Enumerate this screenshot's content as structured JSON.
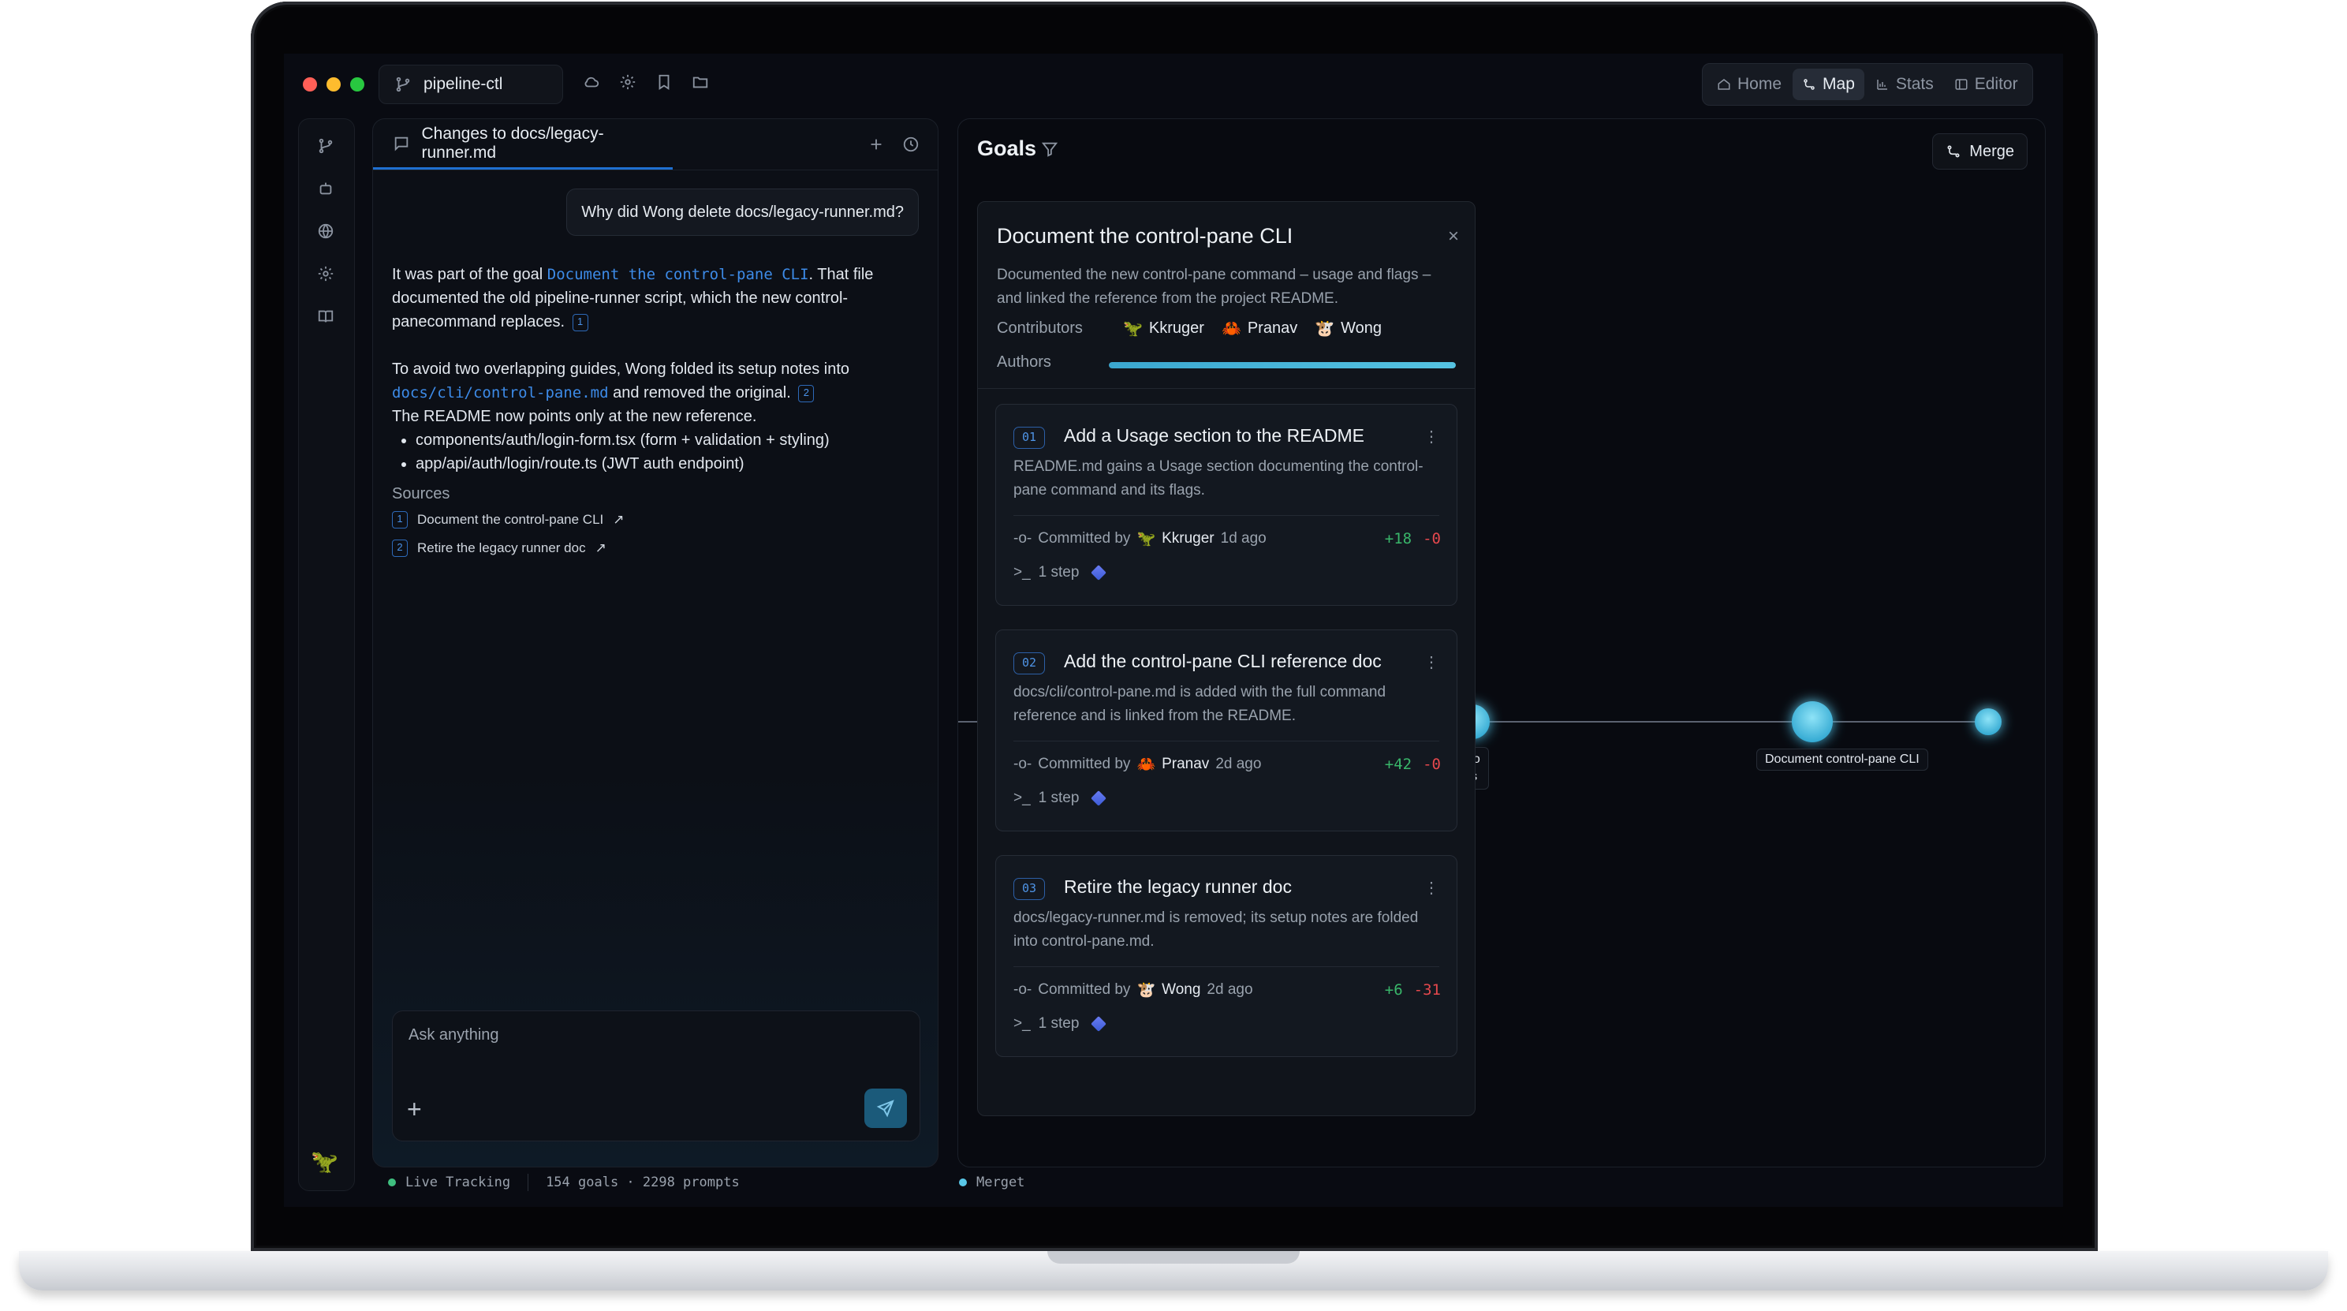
{
  "window": {
    "repo": "pipeline-ctl",
    "traffic_colors": [
      "#ff5f57",
      "#febc2e",
      "#28c840"
    ],
    "top_icons": [
      "cloud-icon",
      "gear-icon",
      "bookmark-icon",
      "folder-icon"
    ],
    "nav": [
      {
        "label": "Home",
        "icon": "home-icon",
        "active": false
      },
      {
        "label": "Map",
        "icon": "map-icon",
        "active": true
      },
      {
        "label": "Stats",
        "icon": "stats-icon",
        "active": false
      },
      {
        "label": "Editor",
        "icon": "editor-icon",
        "active": false
      }
    ]
  },
  "rail": {
    "icons": [
      "branch-icon",
      "bot-icon",
      "globe-icon",
      "settings-icon",
      "book-icon"
    ],
    "avatar": "🦖"
  },
  "chat": {
    "tab_title": "Changes to docs/legacy-runner.md",
    "question": "Why did Wong delete docs/legacy-runner.md?",
    "answer": {
      "p1_pre": "It was part of the goal ",
      "p1_code": "Document the control-pane CLI",
      "p1_post": ". That file documented the old pipeline-runner script, which the new control-panecommand replaces.",
      "p1_cite": "1",
      "p2_pre": "To avoid two overlapping guides, Wong folded its setup notes into ",
      "p2_code": "docs/cli/control-pane.md",
      "p2_post": " and removed the original.",
      "p2_cite": "2",
      "p3": "The README now points only at the new reference.",
      "bullets": [
        "components/auth/login-form.tsx (form + validation + styling)",
        "app/api/auth/login/route.ts (JWT auth endpoint)"
      ]
    },
    "sources_title": "Sources",
    "sources": [
      {
        "num": "1",
        "label": "Document the control-pane CLI"
      },
      {
        "num": "2",
        "label": "Retire the legacy runner doc"
      }
    ],
    "ask_placeholder": "Ask anything",
    "ask_plus": "+"
  },
  "goals": {
    "title": "Goals",
    "merge_label": "Merge",
    "graph": {
      "labels": [
        {
          "text": "-reference to\nontract docs"
        },
        {
          "text": "Document control-pane CLI"
        }
      ],
      "line_color": "#5b6270",
      "node_color": "#59c7e8"
    },
    "card": {
      "title": "Document the control-pane CLI",
      "close": "×",
      "description": "Documented the new control-pane command – usage and flags – and linked the reference from the project README.",
      "contributors_label": "Contributors",
      "contributors": [
        {
          "avatar": "🦖",
          "name": "Kkruger"
        },
        {
          "avatar": "🦀",
          "name": "Pranav"
        },
        {
          "avatar": "🐮",
          "name": "Wong"
        }
      ],
      "authors_label": "Authors",
      "authors_fill": 1.0,
      "steps": [
        {
          "num": "01",
          "title": "Add a Usage section to the README",
          "description": "README.md gains a Usage section documenting the control-pane command and its flags.",
          "committed_by": "Committed by",
          "avatar": "🦖",
          "author": "Kkruger",
          "when": "1d ago",
          "added": "+18",
          "removed": "-0",
          "steps": "1 step"
        },
        {
          "num": "02",
          "title": "Add the control-pane CLI reference doc",
          "description": "docs/cli/control-pane.md is added with the full command reference and is linked from the README.",
          "committed_by": "Committed by",
          "avatar": "🦀",
          "author": "Pranav",
          "when": "2d ago",
          "added": "+42",
          "removed": "-0",
          "steps": "1 step"
        },
        {
          "num": "03",
          "title": "Retire the legacy runner doc",
          "description": "docs/legacy-runner.md is removed; its setup notes are folded into control-pane.md.",
          "committed_by": "Committed by",
          "avatar": "🐮",
          "author": "Wong",
          "when": "2d ago",
          "added": "+6",
          "removed": "-31",
          "steps": "1 step"
        }
      ]
    }
  },
  "status": {
    "live": "Live Tracking",
    "counts": "154 goals · 2298 prompts",
    "merget": "Merget",
    "live_color": "#3fbf7f",
    "merget_color": "#59c7e8"
  }
}
